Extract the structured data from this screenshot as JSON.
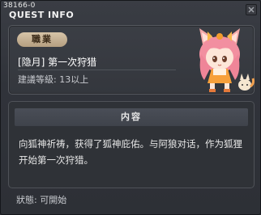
{
  "window": {
    "quest_id": "38166-0",
    "title": "QUEST INFO"
  },
  "info": {
    "category": "職業",
    "quest_name": "[隐月] 第一次狩猎",
    "level_requirement": "建議等級: 13以上"
  },
  "content": {
    "header": "内容",
    "description": "向狐神祈祷，获得了狐神庇佑。与阿狼对话，作为狐狸开始第一次狩猎。"
  },
  "status": {
    "text": "狀態:  可開始"
  },
  "colors": {
    "badge": "#c9b595",
    "panel_border": "#55585e",
    "text": "#e6e6e6"
  },
  "icons": {
    "close": "close-icon",
    "npc": "fox-girl-npc-portrait"
  }
}
